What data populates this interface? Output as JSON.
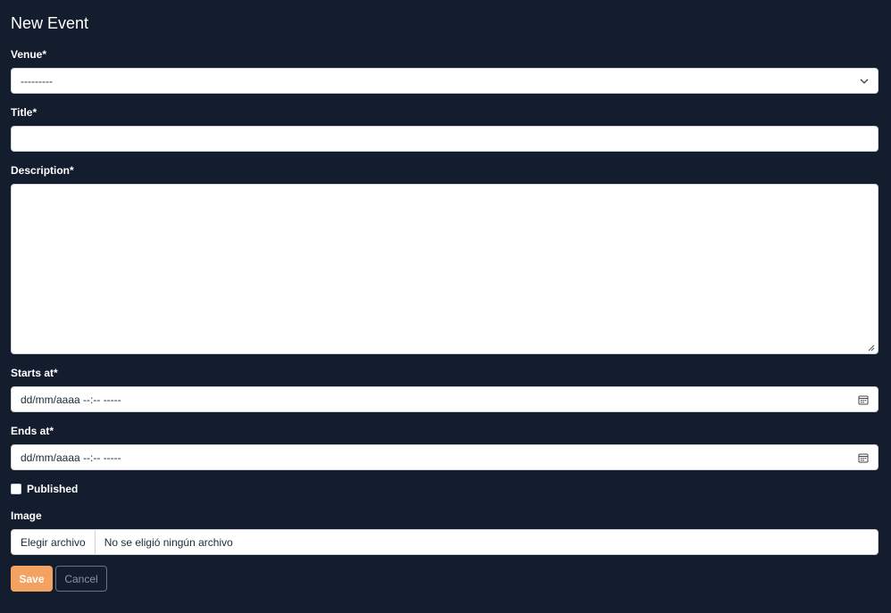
{
  "form": {
    "heading": "New Event",
    "venue": {
      "label": "Venue*",
      "value": "---------"
    },
    "title": {
      "label": "Title*",
      "value": ""
    },
    "description": {
      "label": "Description*",
      "value": ""
    },
    "starts_at": {
      "label": "Starts at*",
      "value": "dd/mm/aaaa --:-- -----"
    },
    "ends_at": {
      "label": "Ends at*",
      "value": "dd/mm/aaaa --:-- -----"
    },
    "published": {
      "label": "Published",
      "checked": false
    },
    "image": {
      "label": "Image",
      "button_label": "Elegir archivo",
      "status": "No se eligió ningún archivo"
    },
    "save_label": "Save",
    "cancel_label": "Cancel"
  },
  "colors": {
    "background": "#131d2e",
    "accent": "#f4a261",
    "field": "#ffffff"
  }
}
